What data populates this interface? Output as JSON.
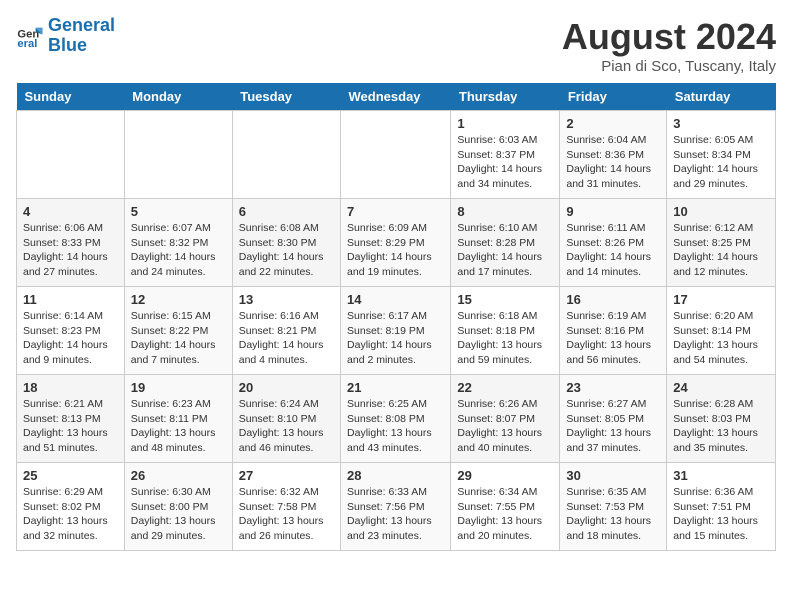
{
  "header": {
    "logo_line1": "General",
    "logo_line2": "Blue",
    "month_title": "August 2024",
    "location": "Pian di Sco, Tuscany, Italy"
  },
  "days_of_week": [
    "Sunday",
    "Monday",
    "Tuesday",
    "Wednesday",
    "Thursday",
    "Friday",
    "Saturday"
  ],
  "weeks": [
    [
      {
        "day": "",
        "info": ""
      },
      {
        "day": "",
        "info": ""
      },
      {
        "day": "",
        "info": ""
      },
      {
        "day": "",
        "info": ""
      },
      {
        "day": "1",
        "info": "Sunrise: 6:03 AM\nSunset: 8:37 PM\nDaylight: 14 hours and 34 minutes."
      },
      {
        "day": "2",
        "info": "Sunrise: 6:04 AM\nSunset: 8:36 PM\nDaylight: 14 hours and 31 minutes."
      },
      {
        "day": "3",
        "info": "Sunrise: 6:05 AM\nSunset: 8:34 PM\nDaylight: 14 hours and 29 minutes."
      }
    ],
    [
      {
        "day": "4",
        "info": "Sunrise: 6:06 AM\nSunset: 8:33 PM\nDaylight: 14 hours and 27 minutes."
      },
      {
        "day": "5",
        "info": "Sunrise: 6:07 AM\nSunset: 8:32 PM\nDaylight: 14 hours and 24 minutes."
      },
      {
        "day": "6",
        "info": "Sunrise: 6:08 AM\nSunset: 8:30 PM\nDaylight: 14 hours and 22 minutes."
      },
      {
        "day": "7",
        "info": "Sunrise: 6:09 AM\nSunset: 8:29 PM\nDaylight: 14 hours and 19 minutes."
      },
      {
        "day": "8",
        "info": "Sunrise: 6:10 AM\nSunset: 8:28 PM\nDaylight: 14 hours and 17 minutes."
      },
      {
        "day": "9",
        "info": "Sunrise: 6:11 AM\nSunset: 8:26 PM\nDaylight: 14 hours and 14 minutes."
      },
      {
        "day": "10",
        "info": "Sunrise: 6:12 AM\nSunset: 8:25 PM\nDaylight: 14 hours and 12 minutes."
      }
    ],
    [
      {
        "day": "11",
        "info": "Sunrise: 6:14 AM\nSunset: 8:23 PM\nDaylight: 14 hours and 9 minutes."
      },
      {
        "day": "12",
        "info": "Sunrise: 6:15 AM\nSunset: 8:22 PM\nDaylight: 14 hours and 7 minutes."
      },
      {
        "day": "13",
        "info": "Sunrise: 6:16 AM\nSunset: 8:21 PM\nDaylight: 14 hours and 4 minutes."
      },
      {
        "day": "14",
        "info": "Sunrise: 6:17 AM\nSunset: 8:19 PM\nDaylight: 14 hours and 2 minutes."
      },
      {
        "day": "15",
        "info": "Sunrise: 6:18 AM\nSunset: 8:18 PM\nDaylight: 13 hours and 59 minutes."
      },
      {
        "day": "16",
        "info": "Sunrise: 6:19 AM\nSunset: 8:16 PM\nDaylight: 13 hours and 56 minutes."
      },
      {
        "day": "17",
        "info": "Sunrise: 6:20 AM\nSunset: 8:14 PM\nDaylight: 13 hours and 54 minutes."
      }
    ],
    [
      {
        "day": "18",
        "info": "Sunrise: 6:21 AM\nSunset: 8:13 PM\nDaylight: 13 hours and 51 minutes."
      },
      {
        "day": "19",
        "info": "Sunrise: 6:23 AM\nSunset: 8:11 PM\nDaylight: 13 hours and 48 minutes."
      },
      {
        "day": "20",
        "info": "Sunrise: 6:24 AM\nSunset: 8:10 PM\nDaylight: 13 hours and 46 minutes."
      },
      {
        "day": "21",
        "info": "Sunrise: 6:25 AM\nSunset: 8:08 PM\nDaylight: 13 hours and 43 minutes."
      },
      {
        "day": "22",
        "info": "Sunrise: 6:26 AM\nSunset: 8:07 PM\nDaylight: 13 hours and 40 minutes."
      },
      {
        "day": "23",
        "info": "Sunrise: 6:27 AM\nSunset: 8:05 PM\nDaylight: 13 hours and 37 minutes."
      },
      {
        "day": "24",
        "info": "Sunrise: 6:28 AM\nSunset: 8:03 PM\nDaylight: 13 hours and 35 minutes."
      }
    ],
    [
      {
        "day": "25",
        "info": "Sunrise: 6:29 AM\nSunset: 8:02 PM\nDaylight: 13 hours and 32 minutes."
      },
      {
        "day": "26",
        "info": "Sunrise: 6:30 AM\nSunset: 8:00 PM\nDaylight: 13 hours and 29 minutes."
      },
      {
        "day": "27",
        "info": "Sunrise: 6:32 AM\nSunset: 7:58 PM\nDaylight: 13 hours and 26 minutes."
      },
      {
        "day": "28",
        "info": "Sunrise: 6:33 AM\nSunset: 7:56 PM\nDaylight: 13 hours and 23 minutes."
      },
      {
        "day": "29",
        "info": "Sunrise: 6:34 AM\nSunset: 7:55 PM\nDaylight: 13 hours and 20 minutes."
      },
      {
        "day": "30",
        "info": "Sunrise: 6:35 AM\nSunset: 7:53 PM\nDaylight: 13 hours and 18 minutes."
      },
      {
        "day": "31",
        "info": "Sunrise: 6:36 AM\nSunset: 7:51 PM\nDaylight: 13 hours and 15 minutes."
      }
    ]
  ]
}
